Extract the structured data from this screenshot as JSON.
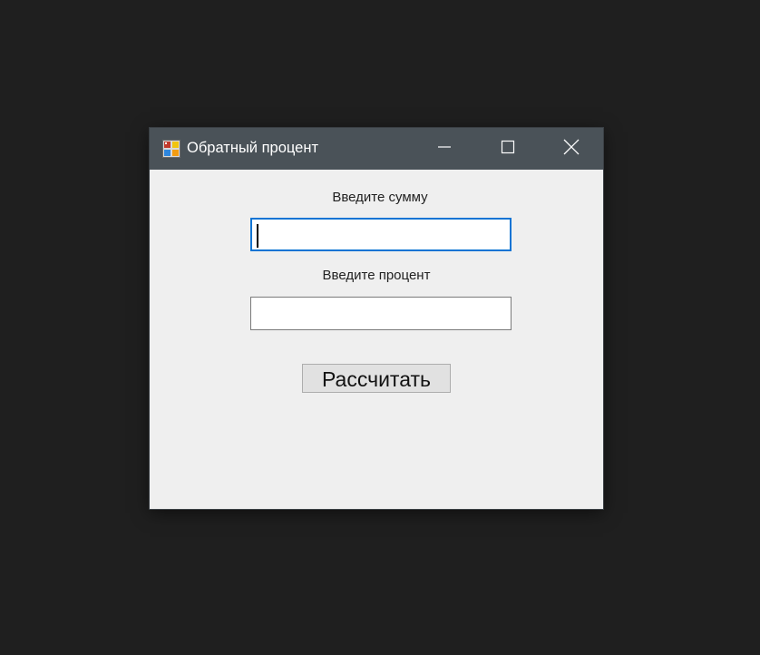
{
  "window": {
    "title": "Обратный процент",
    "controls": {
      "minimize": "minimize-icon",
      "maximize": "maximize-icon",
      "close": "close-icon"
    }
  },
  "form": {
    "sum_label": "Введите сумму",
    "sum_value": "",
    "percent_label": "Введите процент",
    "percent_value": "",
    "calculate_button": "Рассчитать"
  },
  "colors": {
    "desktop": "#1f1f1f",
    "titlebar": "#4a5258",
    "client": "#efefef",
    "focus_border": "#0b74d4"
  }
}
